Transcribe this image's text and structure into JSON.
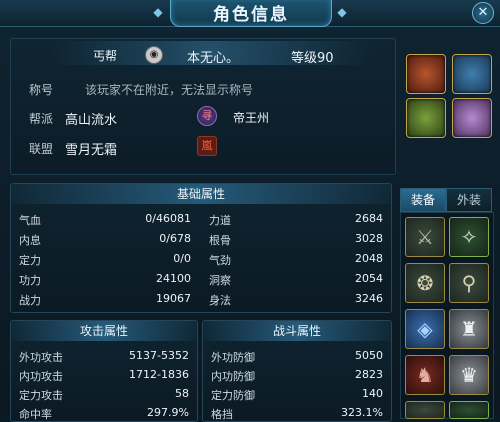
{
  "window": {
    "title": "角色信息",
    "close_symbol": "✕"
  },
  "profile": {
    "school": "丐帮",
    "name": "本无心。",
    "level_text": "等级90",
    "title_label": "称号",
    "title_value": "该玩家不在附近，无法显示称号",
    "guild_label": "帮派",
    "guild_value": "高山流水",
    "guild_badge": "寻",
    "guild_rank": "帝王州",
    "alliance_label": "联盟",
    "alliance_value": "雪月无霜",
    "alliance_badge": "嵐"
  },
  "basic": {
    "header": "基础属性",
    "left": [
      {
        "label": "气血",
        "value": "0/46081"
      },
      {
        "label": "内息",
        "value": "0/678"
      },
      {
        "label": "定力",
        "value": "0/0"
      },
      {
        "label": "功力",
        "value": "24100"
      },
      {
        "label": "战力",
        "value": "19067"
      }
    ],
    "right": [
      {
        "label": "力道",
        "value": "2684"
      },
      {
        "label": "根骨",
        "value": "3028"
      },
      {
        "label": "气劲",
        "value": "2048"
      },
      {
        "label": "洞察",
        "value": "2054"
      },
      {
        "label": "身法",
        "value": "3246"
      }
    ]
  },
  "attack": {
    "header": "攻击属性",
    "rows": [
      {
        "label": "外功攻击",
        "value": "5137-5352"
      },
      {
        "label": "内功攻击",
        "value": "1712-1836"
      },
      {
        "label": "定力攻击",
        "value": "58"
      },
      {
        "label": "命中率",
        "value": "297.9%"
      }
    ]
  },
  "combat": {
    "header": "战斗属性",
    "rows": [
      {
        "label": "外功防御",
        "value": "5050"
      },
      {
        "label": "内功防御",
        "value": "2823"
      },
      {
        "label": "定力防御",
        "value": "140"
      },
      {
        "label": "格挡",
        "value": "323.1%"
      }
    ]
  },
  "equipment": {
    "tabs": [
      {
        "label": "装备"
      },
      {
        "label": "外装"
      }
    ]
  },
  "colors": {
    "accent": "#2a6d91",
    "gold": "#c3a74a",
    "green": "#6ea344"
  }
}
